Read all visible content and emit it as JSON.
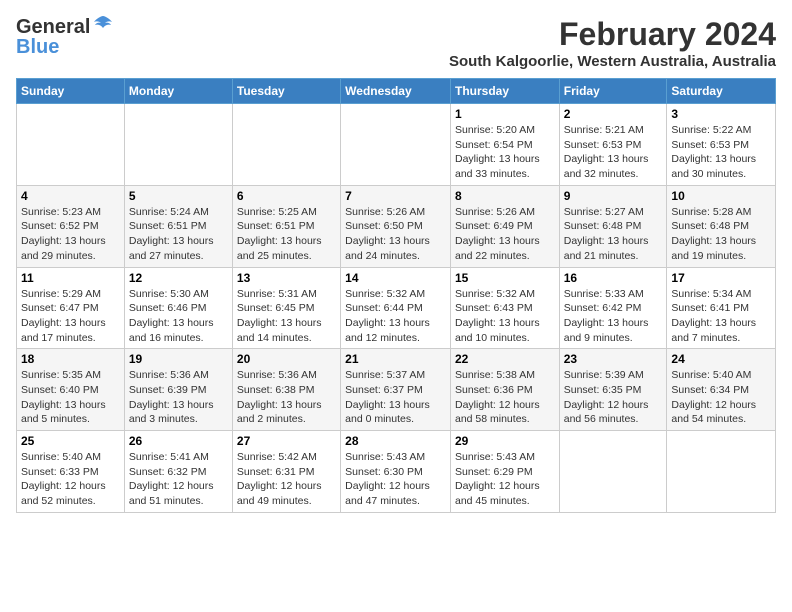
{
  "logo": {
    "line1": "General",
    "line2": "Blue"
  },
  "title": "February 2024",
  "subtitle": "South Kalgoorlie, Western Australia, Australia",
  "weekdays": [
    "Sunday",
    "Monday",
    "Tuesday",
    "Wednesday",
    "Thursday",
    "Friday",
    "Saturday"
  ],
  "weeks": [
    [
      {
        "day": "",
        "info": ""
      },
      {
        "day": "",
        "info": ""
      },
      {
        "day": "",
        "info": ""
      },
      {
        "day": "",
        "info": ""
      },
      {
        "day": "1",
        "info": "Sunrise: 5:20 AM\nSunset: 6:54 PM\nDaylight: 13 hours\nand 33 minutes."
      },
      {
        "day": "2",
        "info": "Sunrise: 5:21 AM\nSunset: 6:53 PM\nDaylight: 13 hours\nand 32 minutes."
      },
      {
        "day": "3",
        "info": "Sunrise: 5:22 AM\nSunset: 6:53 PM\nDaylight: 13 hours\nand 30 minutes."
      }
    ],
    [
      {
        "day": "4",
        "info": "Sunrise: 5:23 AM\nSunset: 6:52 PM\nDaylight: 13 hours\nand 29 minutes."
      },
      {
        "day": "5",
        "info": "Sunrise: 5:24 AM\nSunset: 6:51 PM\nDaylight: 13 hours\nand 27 minutes."
      },
      {
        "day": "6",
        "info": "Sunrise: 5:25 AM\nSunset: 6:51 PM\nDaylight: 13 hours\nand 25 minutes."
      },
      {
        "day": "7",
        "info": "Sunrise: 5:26 AM\nSunset: 6:50 PM\nDaylight: 13 hours\nand 24 minutes."
      },
      {
        "day": "8",
        "info": "Sunrise: 5:26 AM\nSunset: 6:49 PM\nDaylight: 13 hours\nand 22 minutes."
      },
      {
        "day": "9",
        "info": "Sunrise: 5:27 AM\nSunset: 6:48 PM\nDaylight: 13 hours\nand 21 minutes."
      },
      {
        "day": "10",
        "info": "Sunrise: 5:28 AM\nSunset: 6:48 PM\nDaylight: 13 hours\nand 19 minutes."
      }
    ],
    [
      {
        "day": "11",
        "info": "Sunrise: 5:29 AM\nSunset: 6:47 PM\nDaylight: 13 hours\nand 17 minutes."
      },
      {
        "day": "12",
        "info": "Sunrise: 5:30 AM\nSunset: 6:46 PM\nDaylight: 13 hours\nand 16 minutes."
      },
      {
        "day": "13",
        "info": "Sunrise: 5:31 AM\nSunset: 6:45 PM\nDaylight: 13 hours\nand 14 minutes."
      },
      {
        "day": "14",
        "info": "Sunrise: 5:32 AM\nSunset: 6:44 PM\nDaylight: 13 hours\nand 12 minutes."
      },
      {
        "day": "15",
        "info": "Sunrise: 5:32 AM\nSunset: 6:43 PM\nDaylight: 13 hours\nand 10 minutes."
      },
      {
        "day": "16",
        "info": "Sunrise: 5:33 AM\nSunset: 6:42 PM\nDaylight: 13 hours\nand 9 minutes."
      },
      {
        "day": "17",
        "info": "Sunrise: 5:34 AM\nSunset: 6:41 PM\nDaylight: 13 hours\nand 7 minutes."
      }
    ],
    [
      {
        "day": "18",
        "info": "Sunrise: 5:35 AM\nSunset: 6:40 PM\nDaylight: 13 hours\nand 5 minutes."
      },
      {
        "day": "19",
        "info": "Sunrise: 5:36 AM\nSunset: 6:39 PM\nDaylight: 13 hours\nand 3 minutes."
      },
      {
        "day": "20",
        "info": "Sunrise: 5:36 AM\nSunset: 6:38 PM\nDaylight: 13 hours\nand 2 minutes."
      },
      {
        "day": "21",
        "info": "Sunrise: 5:37 AM\nSunset: 6:37 PM\nDaylight: 13 hours\nand 0 minutes."
      },
      {
        "day": "22",
        "info": "Sunrise: 5:38 AM\nSunset: 6:36 PM\nDaylight: 12 hours\nand 58 minutes."
      },
      {
        "day": "23",
        "info": "Sunrise: 5:39 AM\nSunset: 6:35 PM\nDaylight: 12 hours\nand 56 minutes."
      },
      {
        "day": "24",
        "info": "Sunrise: 5:40 AM\nSunset: 6:34 PM\nDaylight: 12 hours\nand 54 minutes."
      }
    ],
    [
      {
        "day": "25",
        "info": "Sunrise: 5:40 AM\nSunset: 6:33 PM\nDaylight: 12 hours\nand 52 minutes."
      },
      {
        "day": "26",
        "info": "Sunrise: 5:41 AM\nSunset: 6:32 PM\nDaylight: 12 hours\nand 51 minutes."
      },
      {
        "day": "27",
        "info": "Sunrise: 5:42 AM\nSunset: 6:31 PM\nDaylight: 12 hours\nand 49 minutes."
      },
      {
        "day": "28",
        "info": "Sunrise: 5:43 AM\nSunset: 6:30 PM\nDaylight: 12 hours\nand 47 minutes."
      },
      {
        "day": "29",
        "info": "Sunrise: 5:43 AM\nSunset: 6:29 PM\nDaylight: 12 hours\nand 45 minutes."
      },
      {
        "day": "",
        "info": ""
      },
      {
        "day": "",
        "info": ""
      }
    ]
  ]
}
